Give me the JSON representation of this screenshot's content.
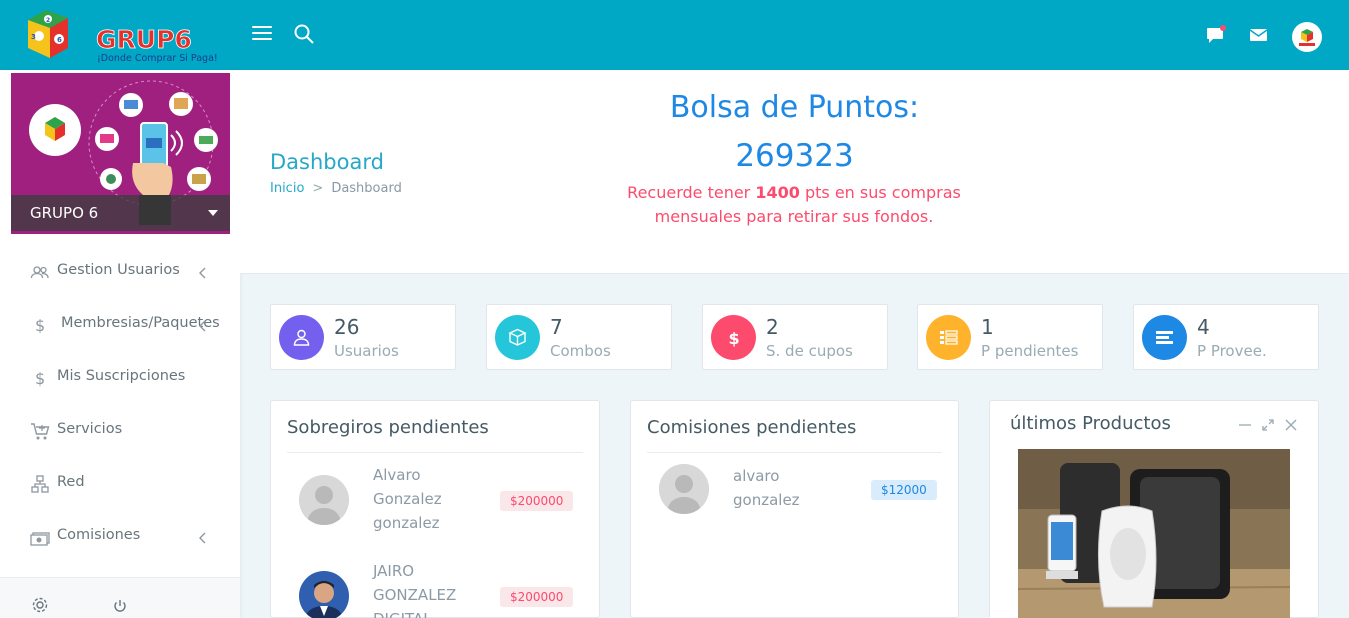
{
  "brand": {
    "name": "GRUP6",
    "tagline": "¡Donde Comprar Si Paga!"
  },
  "topbar": {
    "icons": [
      "menu-icon",
      "search-icon",
      "chat-icon",
      "mail-icon",
      "user-avatar"
    ]
  },
  "sidebar": {
    "profile_name": "GRUPO 6",
    "items": [
      {
        "label": "Gestion Usuarios",
        "icon": "users-icon",
        "has_chevron": true
      },
      {
        "label": "Membresias/Paquetes",
        "icon": "dollar-icon",
        "has_chevron": true
      },
      {
        "label": "Mis Suscripciones",
        "icon": "dollar-icon",
        "has_chevron": false
      },
      {
        "label": "Servicios",
        "icon": "cart-icon",
        "has_chevron": false
      },
      {
        "label": "Red",
        "icon": "network-icon",
        "has_chevron": false
      },
      {
        "label": "Comisiones",
        "icon": "money-icon",
        "has_chevron": true
      }
    ],
    "footer_icons": [
      "settings-icon",
      "power-icon"
    ]
  },
  "header": {
    "page_title": "Dashboard",
    "breadcrumb": {
      "home": "Inicio",
      "current": "Dashboard"
    },
    "bolsa_title": "Bolsa de Puntos:",
    "bolsa_value": "269323",
    "note_pre": "Recuerde tener ",
    "note_bold": "1400",
    "note_post": " pts en sus compras mensuales para retirar sus fondos."
  },
  "stats": [
    {
      "value": "26",
      "label": "Usuarios",
      "color": "#7460ee",
      "icon": "user-icon"
    },
    {
      "value": "7",
      "label": "Combos",
      "color": "#26c6da",
      "icon": "box-icon"
    },
    {
      "value": "2",
      "label": "S. de cupos",
      "color": "#fc4b6c",
      "icon": "dollar-icon"
    },
    {
      "value": "1",
      "label": "P pendientes",
      "color": "#ffb22b",
      "icon": "list-icon"
    },
    {
      "value": "4",
      "label": "P Provee.",
      "color": "#1e88e5",
      "icon": "list-icon"
    }
  ],
  "sobregiros": {
    "title": "Sobregiros pendientes",
    "rows": [
      {
        "name": [
          "Alvaro",
          "Gonzalez",
          "gonzalez"
        ],
        "amount": "$200000"
      },
      {
        "name": [
          "JAIRO",
          "GONZALEZ",
          "DIGITAL"
        ],
        "amount": "$200000"
      }
    ]
  },
  "comisiones": {
    "title": "Comisiones pendientes",
    "rows": [
      {
        "name": [
          "alvaro",
          "gonzalez"
        ],
        "amount": "$12000"
      }
    ]
  },
  "productos": {
    "title": "últimos Productos"
  },
  "colors": {
    "topbar": "#00a8c6",
    "accent": "#1e88e5",
    "danger": "#fc4b6c",
    "profile_bg": "#a0207f"
  }
}
